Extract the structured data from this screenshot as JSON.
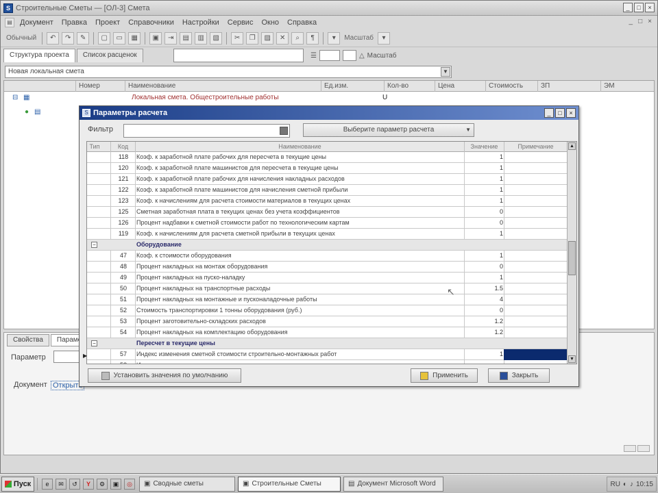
{
  "window": {
    "title": "Строительные Сметы — [ОЛ-3] Смета",
    "controls": [
      "_",
      "□",
      "×"
    ]
  },
  "menubar": {
    "items": [
      "Документ",
      "Правка",
      "Проект",
      "Справочники",
      "Настройки",
      "Сервис",
      "Окно",
      "Справка"
    ],
    "right": [
      "_",
      "□",
      "×"
    ]
  },
  "toolbar": {
    "style_label": "Обычный",
    "zoom_label": "Масштаб"
  },
  "tabs": [
    "Структура проекта",
    "Список расценок"
  ],
  "address": "Новая локальная смета",
  "grid": {
    "columns": [
      "Номер",
      "Наименование",
      "Ед.изм.",
      "Кол-во",
      "Цена",
      "Стоимость",
      "ЗП",
      "ЭМ"
    ],
    "row1_name": "Локальная смета. Общестроительные работы",
    "row1_u": "U"
  },
  "bottom": {
    "tabs": [
      "Свойства",
      "Параметры"
    ],
    "field1_label": "Параметр",
    "field2_label": "Документ",
    "link_text": "Открыть"
  },
  "dialog": {
    "title": "Параметры расчета",
    "filter_label": "Фильтр",
    "mode_select": "Выберите параметр расчета",
    "columns": [
      "Тип",
      "Код",
      "Наименование",
      "Значение",
      "Примечание"
    ],
    "rows": [
      {
        "type": "item",
        "code": "118",
        "name": "Коэф. к заработной плате рабочих для пересчета в текущие цены",
        "value": "1"
      },
      {
        "type": "item",
        "code": "120",
        "name": "Коэф. к заработной плате машинистов для пересчета в текущие цены",
        "value": "1"
      },
      {
        "type": "item",
        "code": "121",
        "name": "Коэф. к заработной плате рабочих для начисления накладных расходов",
        "value": "1"
      },
      {
        "type": "item",
        "code": "122",
        "name": "Коэф. к заработной плате машинистов для начисления сметной прибыли",
        "value": "1"
      },
      {
        "type": "item",
        "code": "123",
        "name": "Коэф. к начислениям для расчета стоимости материалов в текущих ценах",
        "value": "1"
      },
      {
        "type": "item",
        "code": "125",
        "name": "Сметная заработная плата в текущих ценах без учета коэффициентов",
        "value": "0"
      },
      {
        "type": "item",
        "code": "126",
        "name": "Процент надбавки к сметной стоимости работ по технологическим картам",
        "value": "0"
      },
      {
        "type": "item",
        "code": "119",
        "name": "Коэф. к начислениям для расчета сметной прибыли в текущих ценах",
        "value": "1"
      },
      {
        "type": "group",
        "code": "",
        "name": "Оборудование",
        "value": ""
      },
      {
        "type": "item",
        "code": "47",
        "name": "Коэф. к стоимости оборудования",
        "value": "1"
      },
      {
        "type": "item",
        "code": "48",
        "name": "Процент накладных на монтаж оборудования",
        "value": "0"
      },
      {
        "type": "item",
        "code": "49",
        "name": "Процент накладных на пуско-наладку",
        "value": "1"
      },
      {
        "type": "item",
        "code": "50",
        "name": "Процент накладных на транспортные расходы",
        "value": "1.5"
      },
      {
        "type": "item",
        "code": "51",
        "name": "Процент накладных на монтажные и пусконаладочные работы",
        "value": "4"
      },
      {
        "type": "item",
        "code": "52",
        "name": "Стоимость транспортировки 1 тонны оборудования (руб.)",
        "value": "0"
      },
      {
        "type": "item",
        "code": "53",
        "name": "Процент заготовительно-складских расходов",
        "value": "1.2"
      },
      {
        "type": "item",
        "code": "54",
        "name": "Процент накладных на комплектацию оборудования",
        "value": "1.2"
      },
      {
        "type": "group",
        "code": "",
        "name": "Пересчет в текущие цены",
        "value": ""
      },
      {
        "type": "item",
        "code": "57",
        "name": "Индекс изменения сметной стоимости строительно-монтажных работ",
        "value": "1"
      },
      {
        "type": "item",
        "code": "58",
        "name": "И",
        "value": ""
      }
    ],
    "reset_button": "Установить значения по умолчанию",
    "apply_button": "Применить",
    "close_button": "Закрыть"
  },
  "taskbar": {
    "start": "Пуск",
    "quick_launch": [
      "e",
      "✉",
      "↺",
      "Y",
      "⚙",
      "▣",
      "◎"
    ],
    "tasks": [
      {
        "label": "Сводные сметы",
        "active": false
      },
      {
        "label": "Строительные Сметы",
        "active": true
      },
      {
        "label": "Документ Microsoft Word",
        "active": false
      }
    ],
    "clock": "10:15",
    "lang": "RU"
  }
}
